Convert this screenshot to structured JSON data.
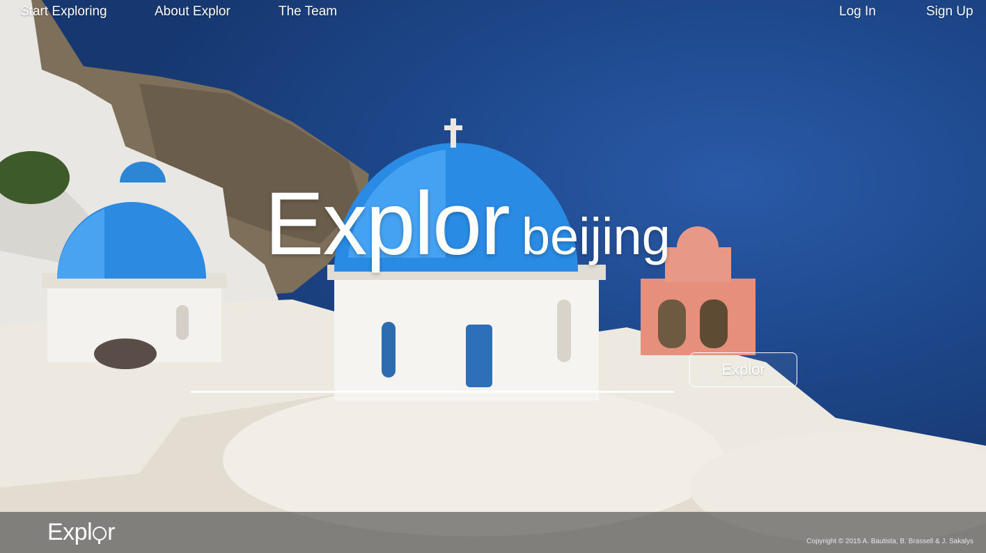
{
  "nav": {
    "left": [
      "Start Exploring",
      "About Explor",
      "The Team"
    ],
    "right": [
      "Log In",
      "Sign Up"
    ]
  },
  "hero": {
    "title": "Explor",
    "city": "beijing",
    "search_value": "",
    "search_placeholder": "",
    "button_label": "Explor"
  },
  "footer": {
    "logo_left": "Expl",
    "logo_right": "r",
    "copyright": "Copyright © 2015 A. Bautista, B. Brassell & J. Sakalys"
  },
  "colors": {
    "sea": "#1f4a8f",
    "dome_blue": "#2f8ee3",
    "white_wash": "#f2efe9",
    "bell_tower": "#e6907f",
    "footer_bar": "#464646"
  },
  "icons": [
    "globe-icon"
  ]
}
